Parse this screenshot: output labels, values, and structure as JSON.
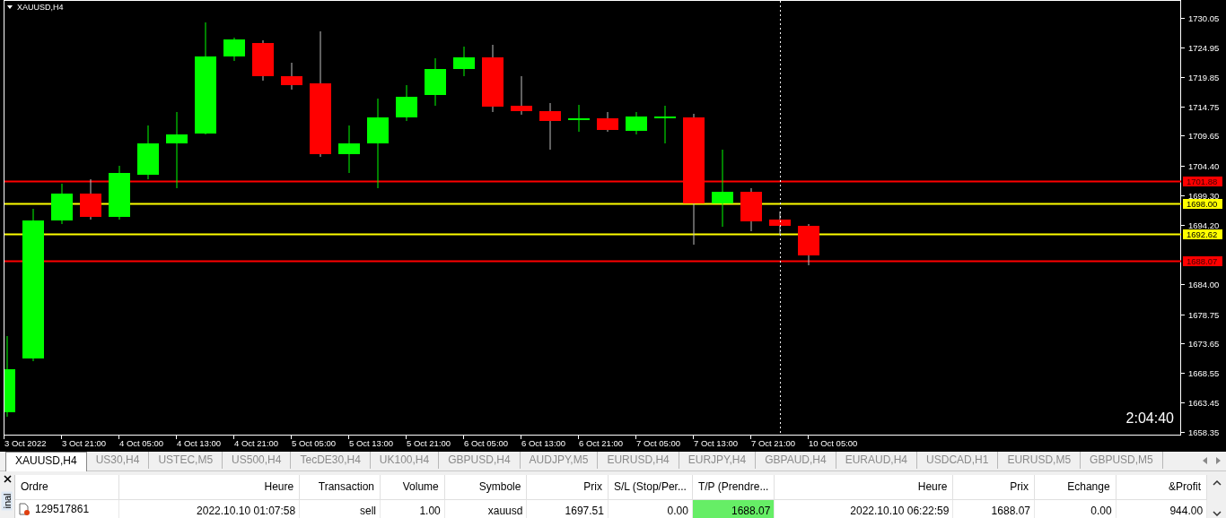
{
  "chart": {
    "title": "XAUUSD,H4",
    "countdown": "2:04:40",
    "yticks": [
      "1730.05",
      "1724.95",
      "1719.85",
      "1714.75",
      "1709.65",
      "1704.40",
      "1699.30",
      "1694.20",
      "1684.00",
      "1678.75",
      "1673.65",
      "1668.55",
      "1663.45",
      "1658.35"
    ],
    "price_lines": [
      {
        "price": "1701.88",
        "color": "#ff0000"
      },
      {
        "price": "1698.00",
        "color": "#ffff00"
      },
      {
        "price": "1692.62",
        "color": "#ffff00"
      },
      {
        "price": "1688.07",
        "color": "#ff0000"
      }
    ],
    "xlabels": [
      "3 Oct 2022",
      "3 Oct 21:00",
      "4 Oct 05:00",
      "4 Oct 13:00",
      "4 Oct 21:00",
      "5 Oct 05:00",
      "5 Oct 13:00",
      "5 Oct 21:00",
      "6 Oct 05:00",
      "6 Oct 13:00",
      "6 Oct 21:00",
      "7 Oct 05:00",
      "7 Oct 13:00",
      "7 Oct 21:00",
      "10 Oct 05:00"
    ]
  },
  "tabs": [
    {
      "label": "XAUUSD,H4",
      "selected": true
    },
    {
      "label": "US30,H4",
      "selected": false
    },
    {
      "label": "USTEC,M5",
      "selected": false
    },
    {
      "label": "US500,H4",
      "selected": false
    },
    {
      "label": "TecDE30,H4",
      "selected": false
    },
    {
      "label": "UK100,H4",
      "selected": false
    },
    {
      "label": "GBPUSD,H4",
      "selected": false
    },
    {
      "label": "AUDJPY,M5",
      "selected": false
    },
    {
      "label": "EURUSD,H4",
      "selected": false
    },
    {
      "label": "EURJPY,H4",
      "selected": false
    },
    {
      "label": "GBPAUD,H4",
      "selected": false
    },
    {
      "label": "EURAUD,H4",
      "selected": false
    },
    {
      "label": "USDCAD,H1",
      "selected": false
    },
    {
      "label": "EURUSD,M5",
      "selected": false
    },
    {
      "label": "GBPUSD,M5",
      "selected": false
    }
  ],
  "terminal": {
    "side_label": "inal",
    "columns": [
      "Ordre",
      "Heure",
      "Transaction",
      "Volume",
      "Symbole",
      "Prix",
      "S/L (Stop/Per...",
      "T/P (Prendre...",
      "Heure",
      "Prix",
      "Echange",
      "&Profit"
    ],
    "rows": [
      {
        "cells": [
          {
            "text": "129517861",
            "highlighted": false
          },
          {
            "text": "2022.10.10 01:07:58",
            "highlighted": false
          },
          {
            "text": "sell",
            "highlighted": false
          },
          {
            "text": "1.00",
            "highlighted": false
          },
          {
            "text": "xauusd",
            "highlighted": false
          },
          {
            "text": "1697.51",
            "highlighted": false
          },
          {
            "text": "0.00",
            "highlighted": false
          },
          {
            "text": "1688.07",
            "highlighted": true
          },
          {
            "text": "2022.10.10 06:22:59",
            "highlighted": false
          },
          {
            "text": "1688.07",
            "highlighted": false
          },
          {
            "text": "0.00",
            "highlighted": false
          },
          {
            "text": "944.00",
            "highlighted": false
          }
        ]
      }
    ]
  }
}
